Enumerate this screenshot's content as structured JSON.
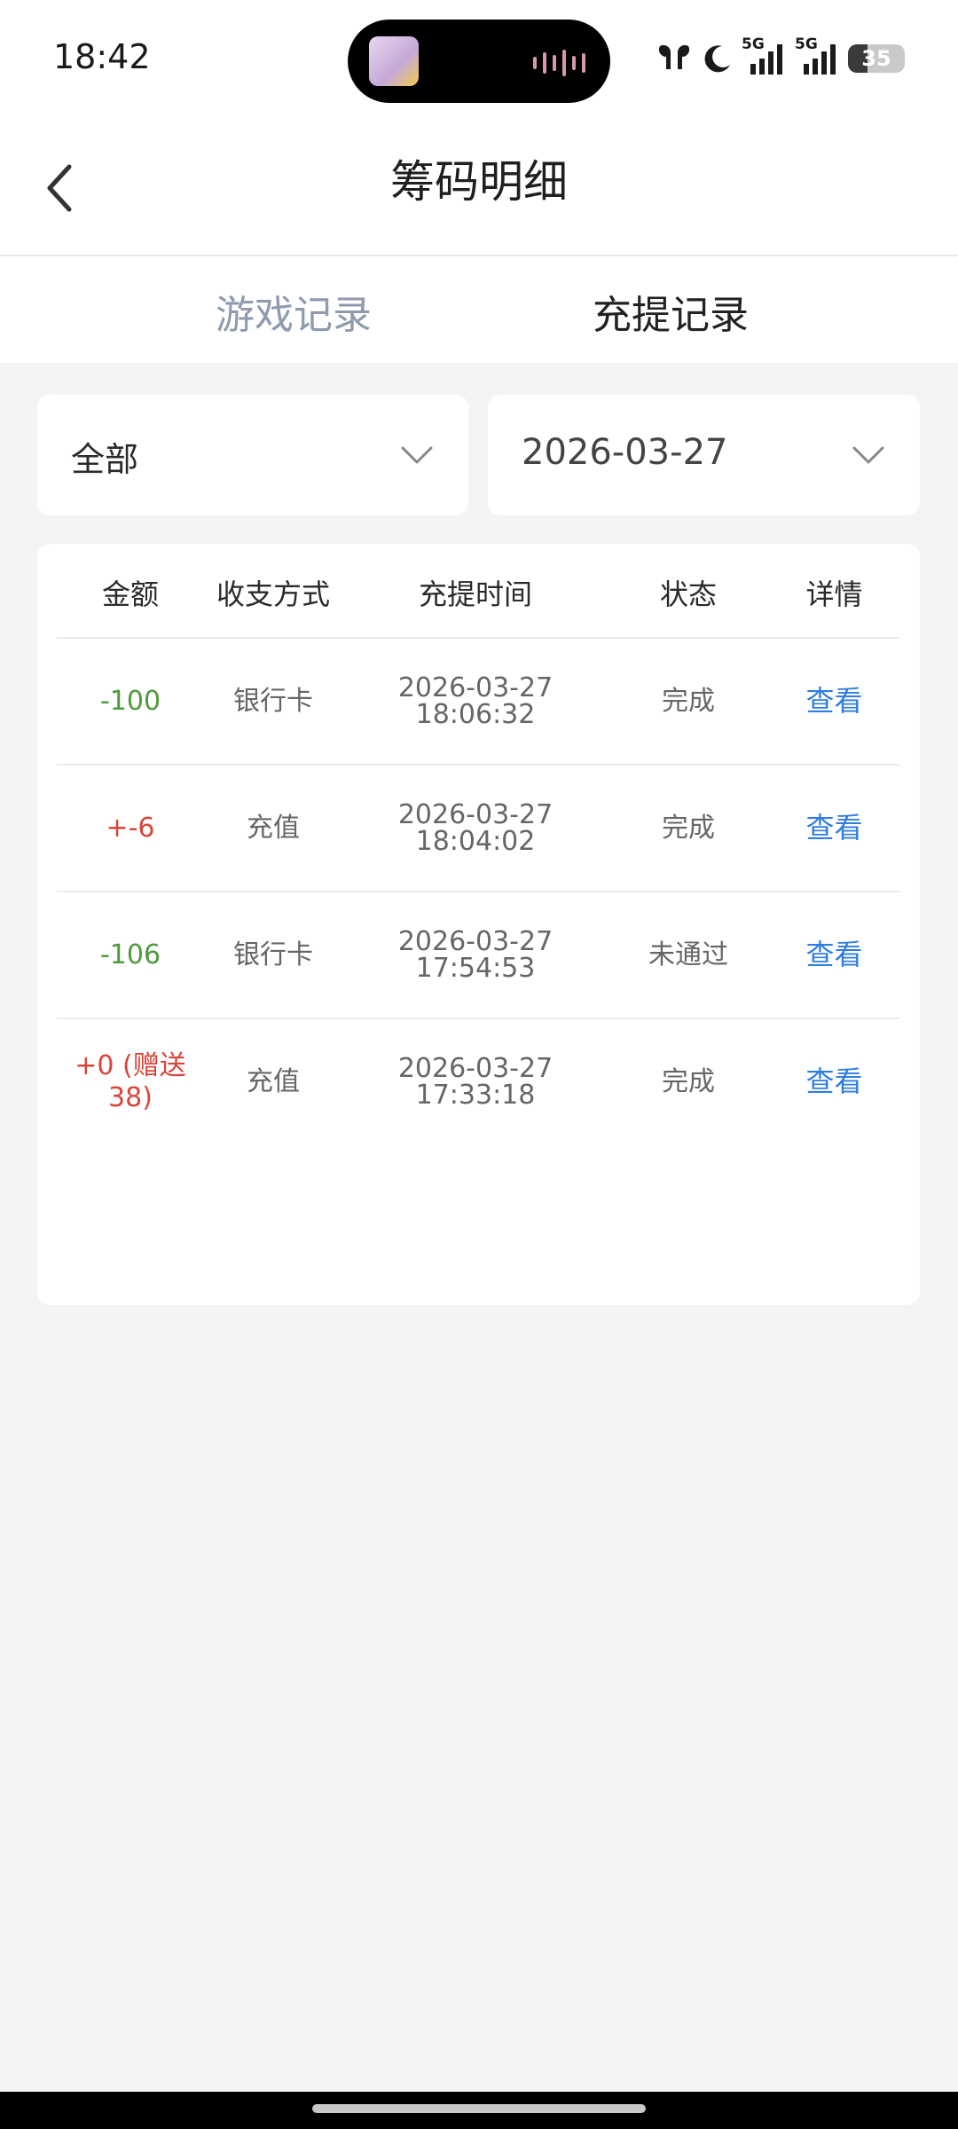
{
  "status_bar": {
    "time": "18:42",
    "network_1": "5G",
    "network_2": "5G",
    "battery": "35",
    "battery_level": 0.35,
    "icons": [
      "earbuds-icon",
      "moon-icon",
      "signal-icon",
      "signal-icon",
      "battery-icon"
    ]
  },
  "header": {
    "title": "筹码明细",
    "back_icon": "chevron-left-icon"
  },
  "tabs": [
    {
      "label": "游戏记录",
      "active": false
    },
    {
      "label": "充提记录",
      "active": true
    }
  ],
  "filters": {
    "type": {
      "value": "全部",
      "icon": "chevron-down-icon"
    },
    "date": {
      "value": "2026-03-27",
      "icon": "chevron-down-icon"
    }
  },
  "table": {
    "headers": [
      "金额",
      "收支方式",
      "充提时间",
      "状态",
      "详情"
    ],
    "rows": [
      {
        "amount": "-100",
        "method": "银行卡",
        "date": "2026-03-27",
        "time": "18:06:32",
        "status": "完成",
        "detail": "查看"
      },
      {
        "amount": "+-6",
        "method": "充值",
        "date": "2026-03-27",
        "time": "18:04:02",
        "status": "完成",
        "detail": "查看"
      },
      {
        "amount": "-106",
        "method": "银行卡",
        "date": "2026-03-27",
        "time": "17:54:53",
        "status": "未通过",
        "detail": "查看"
      },
      {
        "amount": "+0 (赠送38)",
        "method": "充值",
        "date": "2026-03-27",
        "time": "17:33:18",
        "status": "完成",
        "detail": "查看"
      }
    ]
  },
  "colors": {
    "negative_amount": "#4e9a3a",
    "positive_amount": "#d9453a",
    "link": "#2f7de1",
    "inactive_tab": "#8e9aae",
    "background": "#f4f4f5"
  }
}
